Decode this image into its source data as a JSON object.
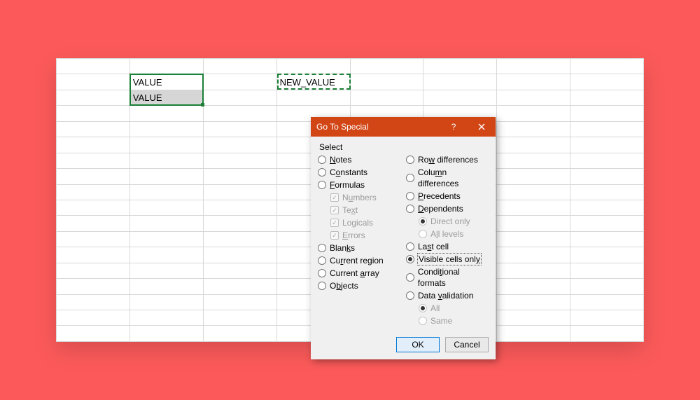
{
  "sheet": {
    "cells": {
      "b2": "VALUE",
      "b3": "VALUE",
      "d2": "NEW_VALUE"
    }
  },
  "dialog": {
    "title": "Go To Special",
    "section_label": "Select",
    "left": {
      "notes": "Notes",
      "constants": "Constants",
      "formulas": "Formulas",
      "numbers": "Numbers",
      "text": "Text",
      "logicals": "Logicals",
      "errors": "Errors",
      "blanks": "Blanks",
      "current_region": "Current region",
      "current_array": "Current array",
      "objects": "Objects"
    },
    "right": {
      "row_diff": "Row differences",
      "col_diff": "Column differences",
      "precedents": "Precedents",
      "dependents": "Dependents",
      "direct_only": "Direct only",
      "all_levels": "All levels",
      "last_cell": "Last cell",
      "visible_cells": "Visible cells only",
      "cond_formats": "Conditional formats",
      "data_validation": "Data validation",
      "all": "All",
      "same": "Same"
    },
    "ok": "OK",
    "cancel": "Cancel",
    "help_tooltip": "?",
    "close_tooltip": "Close"
  },
  "underlines": {
    "notes": "N",
    "constants": "o",
    "formulas": "F",
    "numbers": "u",
    "text": "x",
    "logicals": "g",
    "errors": "E",
    "blanks": "k",
    "current_region": "r",
    "current_array": "a",
    "objects": "b",
    "row_diff": "w",
    "col_diff": "m",
    "precedents": "P",
    "dependents": "D",
    "direct_only": "I",
    "all_levels": "l",
    "last_cell": "s",
    "visible_cells": "y",
    "cond_formats": "t",
    "data_validation": "v"
  }
}
